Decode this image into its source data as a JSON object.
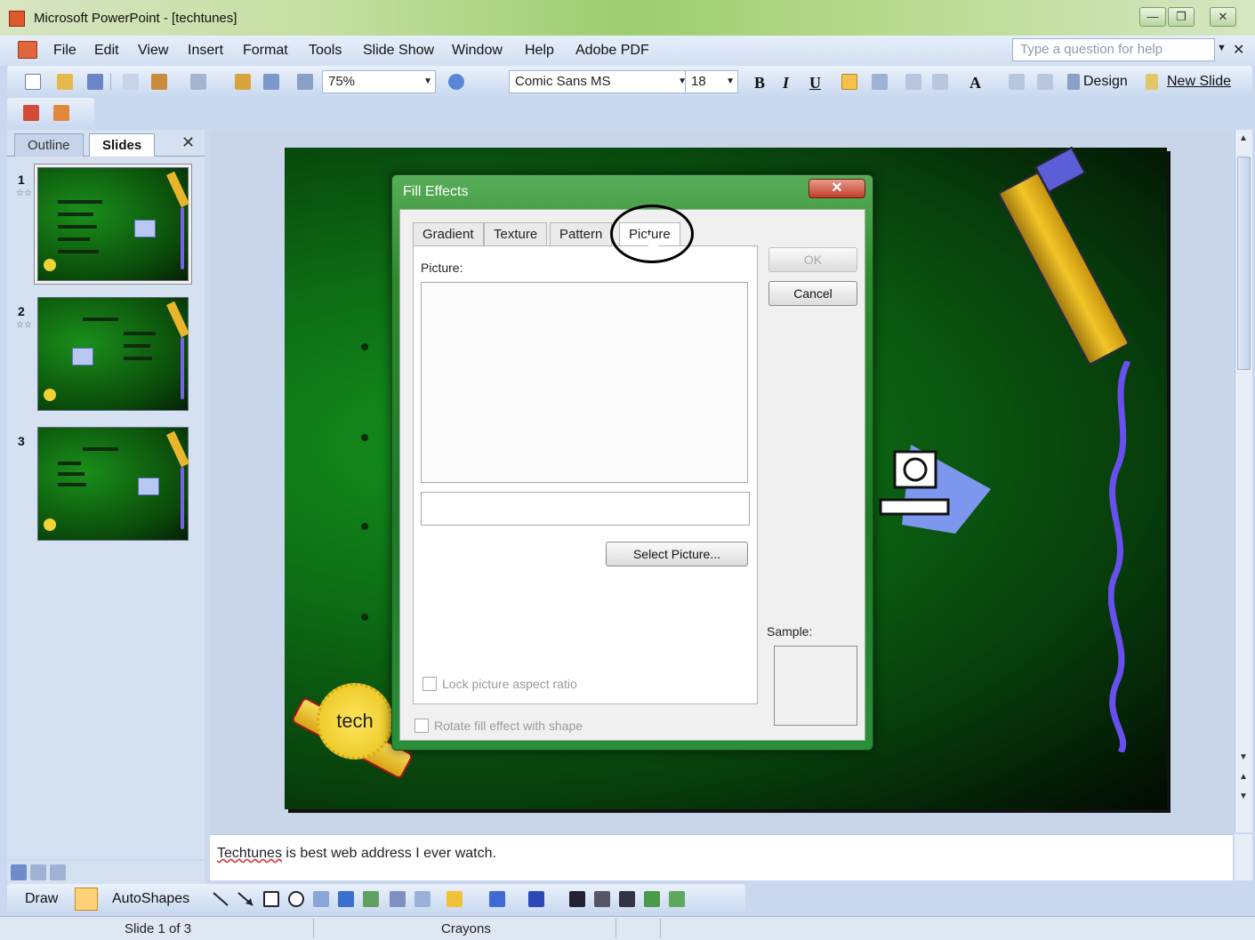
{
  "window": {
    "title": "Microsoft PowerPoint - [techtunes]"
  },
  "menubar": {
    "items": [
      "File",
      "Edit",
      "View",
      "Insert",
      "Format",
      "Tools",
      "Slide Show",
      "Window",
      "Help",
      "Adobe PDF"
    ],
    "help_placeholder": "Type a question for help"
  },
  "toolbar": {
    "zoom": "75%",
    "font": "Comic Sans MS",
    "font_size": "18",
    "bold": "B",
    "italic": "I",
    "underline": "U",
    "grow_font": "A",
    "design": "Design",
    "new_slide": "New Slide"
  },
  "left_pane": {
    "tabs": [
      "Outline",
      "Slides"
    ],
    "active_tab": "Slides",
    "slides": [
      {
        "number": "1",
        "selected": true
      },
      {
        "number": "2",
        "selected": false
      },
      {
        "number": "3",
        "selected": false
      }
    ]
  },
  "slide": {
    "badge_text": "tech"
  },
  "notes": {
    "text_link": "Techtunes",
    "text_rest": " is best web address I ever watch."
  },
  "dialog": {
    "title": "Fill Effects",
    "tabs": [
      "Gradient",
      "Texture",
      "Pattern",
      "Picture"
    ],
    "active_tab": "Picture",
    "picture_label": "Picture:",
    "select_button": "Select Picture...",
    "lock_label": "Lock picture aspect ratio",
    "rotate_label": "Rotate fill effect with shape",
    "ok": "OK",
    "cancel": "Cancel",
    "sample_label": "Sample:"
  },
  "drawbar": {
    "draw": "Draw",
    "autoshapes": "AutoShapes"
  },
  "status": {
    "slide": "Slide 1 of 3",
    "theme": "Crayons"
  },
  "colors": {
    "accent_green": "#1e7a28",
    "office_blue": "#c9d8ee",
    "slide_green": "#0d6a14"
  }
}
